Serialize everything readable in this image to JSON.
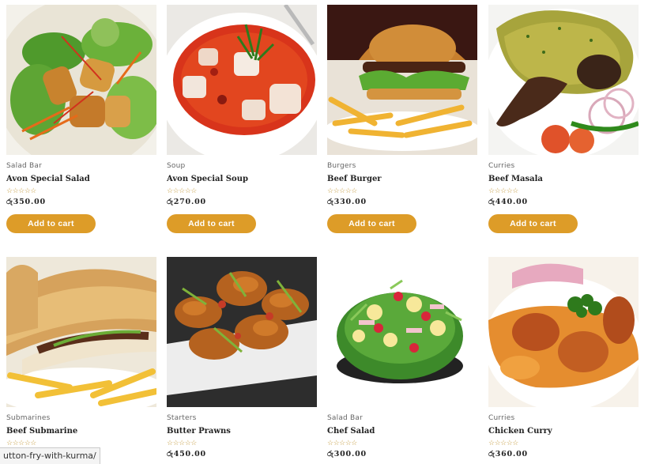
{
  "products": [
    {
      "category": "Salad Bar",
      "name": "Avon Special Salad",
      "rating": "☆☆☆☆☆",
      "price": "රු350.00",
      "button": "Add to cart",
      "image_icon": "salad-image-icon"
    },
    {
      "category": "Soup",
      "name": "Avon Special Soup",
      "rating": "☆☆☆☆☆",
      "price": "රු270.00",
      "button": "Add to cart",
      "image_icon": "soup-image-icon"
    },
    {
      "category": "Burgers",
      "name": "Beef Burger",
      "rating": "☆☆☆☆☆",
      "price": "රු330.00",
      "button": "Add to cart",
      "image_icon": "burger-image-icon"
    },
    {
      "category": "Curries",
      "name": "Beef Masala",
      "rating": "☆☆☆☆☆",
      "price": "රු440.00",
      "button": "Add to cart",
      "image_icon": "masala-image-icon"
    },
    {
      "category": "Submarines",
      "name": "Beef Submarine",
      "rating": "☆☆☆☆☆",
      "price": "",
      "button": "",
      "image_icon": "submarine-image-icon"
    },
    {
      "category": "Starters",
      "name": "Butter Prawns",
      "rating": "☆☆☆☆☆",
      "price": "රු450.00",
      "button": "",
      "image_icon": "prawns-image-icon"
    },
    {
      "category": "Salad Bar",
      "name": "Chef Salad",
      "rating": "☆☆☆☆☆",
      "price": "රු300.00",
      "button": "",
      "image_icon": "chef-salad-image-icon"
    },
    {
      "category": "Curries",
      "name": "Chicken Curry",
      "rating": "☆☆☆☆☆",
      "price": "රු360.00",
      "button": "",
      "image_icon": "curry-image-icon"
    }
  ],
  "status_bar": {
    "url": "utton-fry-with-kurma/"
  },
  "colors": {
    "button": "#dd9c28",
    "star": "#c8a14a"
  }
}
